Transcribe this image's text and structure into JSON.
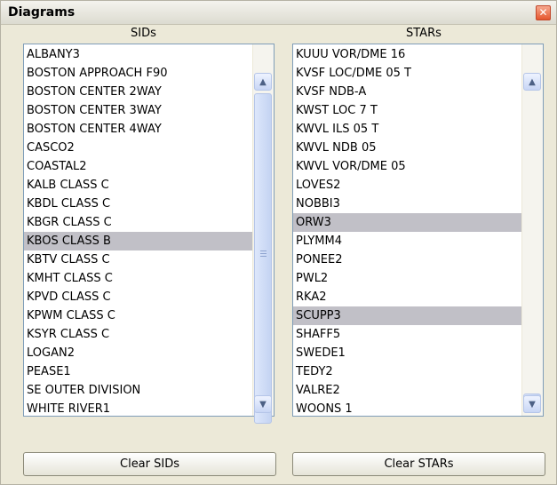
{
  "window": {
    "title": "Diagrams",
    "close_glyph": "✕"
  },
  "sids": {
    "header": "SIDs",
    "items": [
      "ALBANY3",
      "BOSTON APPROACH F90",
      "BOSTON CENTER 2WAY",
      "BOSTON CENTER 3WAY",
      "BOSTON CENTER 4WAY",
      "CASCO2",
      "COASTAL2",
      "KALB CLASS C",
      "KBDL CLASS C",
      "KBGR CLASS C",
      "KBOS CLASS B",
      "KBTV CLASS C",
      "KMHT CLASS C",
      "KPVD CLASS C",
      "KPWM CLASS C",
      "KSYR CLASS C",
      "LOGAN2",
      "PEASE1",
      "SE OUTER DIVISION",
      "WHITE RIVER1"
    ],
    "selected": [
      "KBOS CLASS B"
    ],
    "clear_button": "Clear SIDs"
  },
  "stars": {
    "header": "STARs",
    "items": [
      "KUUU VOR/DME 16",
      "KVSF LOC/DME 05 T",
      "KVSF NDB-A",
      "KWST LOC 7 T",
      "KWVL ILS 05 T",
      "KWVL NDB 05",
      "KWVL VOR/DME 05",
      "LOVES2",
      "NOBBI3",
      "ORW3",
      "PLYMM4",
      "PONEE2",
      "PWL2",
      "RKA2",
      "SCUPP3",
      "SHAFF5",
      "SWEDE1",
      "TEDY2",
      "VALRE2",
      "WOONS 1"
    ],
    "selected": [
      "ORW3",
      "SCUPP3"
    ],
    "clear_button": "Clear STARs"
  },
  "icons": {
    "scroll_up": "chevron-up-icon",
    "scroll_down": "chevron-down-icon"
  },
  "colors": {
    "selection": "#c1c0c7",
    "title_close": "#e5562d"
  }
}
